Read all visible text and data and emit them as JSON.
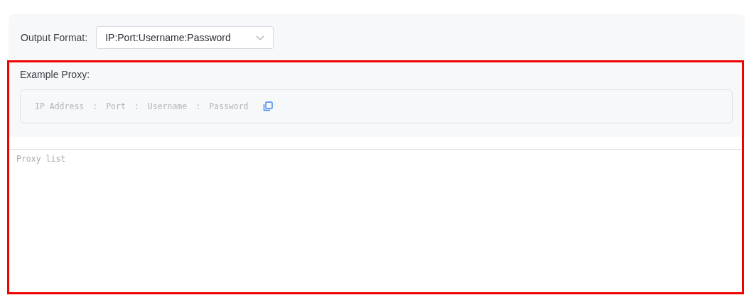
{
  "output_format": {
    "label": "Output Format:",
    "value": "IP:Port:Username:Password"
  },
  "example": {
    "title": "Example Proxy:",
    "parts": [
      {
        "kind": "field",
        "text": "IP Address"
      },
      {
        "kind": "separator",
        "text": ":"
      },
      {
        "kind": "field",
        "text": "Port"
      },
      {
        "kind": "separator",
        "text": ":"
      },
      {
        "kind": "field",
        "text": "Username"
      },
      {
        "kind": "separator",
        "text": ":"
      },
      {
        "kind": "field",
        "text": "Password"
      }
    ]
  },
  "proxy_list": {
    "placeholder": "Proxy list"
  }
}
